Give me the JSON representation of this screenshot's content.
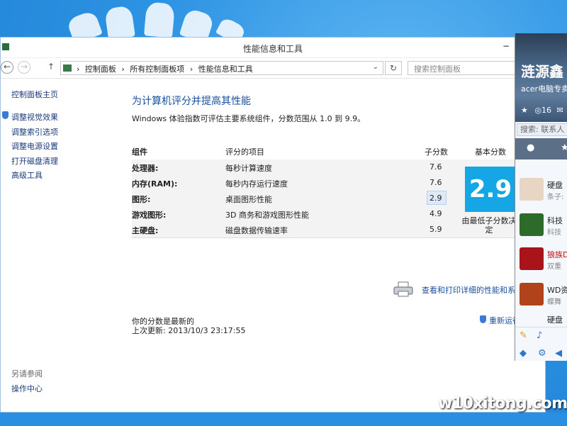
{
  "window": {
    "title": "性能信息和工具",
    "minimize_glyph": "−",
    "back_glyph": "←",
    "forward_glyph": "→",
    "up_glyph": "↑",
    "breadcrumb": [
      "控制面板",
      "所有控制面板项",
      "性能信息和工具"
    ],
    "breadcrumb_sep": "›",
    "dropdown_glyph": "⌄",
    "refresh_glyph": "↻",
    "search_placeholder": "搜索控制面板"
  },
  "sidebar": {
    "home": "控制面板主页",
    "links": [
      "调整视觉效果",
      "调整索引选项",
      "调整电源设置",
      "打开磁盘清理",
      "高级工具"
    ],
    "see_also_heading": "另请参阅",
    "see_also": [
      "操作中心"
    ]
  },
  "main": {
    "heading": "为计算机评分并提高其性能",
    "description": "Windows 体验指数可评估主要系统组件，分数范围从 1.0 到 9.9。",
    "table": {
      "headers": {
        "component": "组件",
        "rated": "评分的项目",
        "subscore": "子分数",
        "basescore": "基本分数"
      },
      "rows": [
        {
          "component": "处理器:",
          "rated": "每秒计算速度",
          "subscore": "7.6"
        },
        {
          "component": "内存(RAM):",
          "rated": "每秒内存运行速度",
          "subscore": "7.6"
        },
        {
          "component": "图形:",
          "rated": "桌面图形性能",
          "subscore": "2.9"
        },
        {
          "component": "游戏图形:",
          "rated": "3D 商务和游戏图形性能",
          "subscore": "4.9"
        },
        {
          "component": "主硬盘:",
          "rated": "磁盘数据传输速率",
          "subscore": "5.9"
        }
      ],
      "base_score": "2.9",
      "base_caption": "由最低子分数决定"
    },
    "print_link": "查看和打印详细的性能和系统",
    "status": "你的分数是最新的",
    "last_update": "上次更新: 2013/10/3 23:17:55",
    "rerun": "重新运行"
  },
  "qq": {
    "name": "涟源鑫",
    "signature": "acer电脑专卖",
    "count": "16",
    "search": "搜索: 联系人",
    "contacts": [
      {
        "name": "硬盘",
        "msg": "条子:"
      },
      {
        "name": "科技",
        "msg": "科技"
      },
      {
        "name": "狼族D",
        "msg": "双重"
      },
      {
        "name": "WD资",
        "msg": "蝶舞"
      },
      {
        "name": "硬盘",
        "msg": ""
      }
    ]
  },
  "watermark": "w10xitong.com",
  "colors": {
    "accent": "#15a6e6",
    "link": "#1a4f9c",
    "desktop": "#2a8fe0"
  }
}
